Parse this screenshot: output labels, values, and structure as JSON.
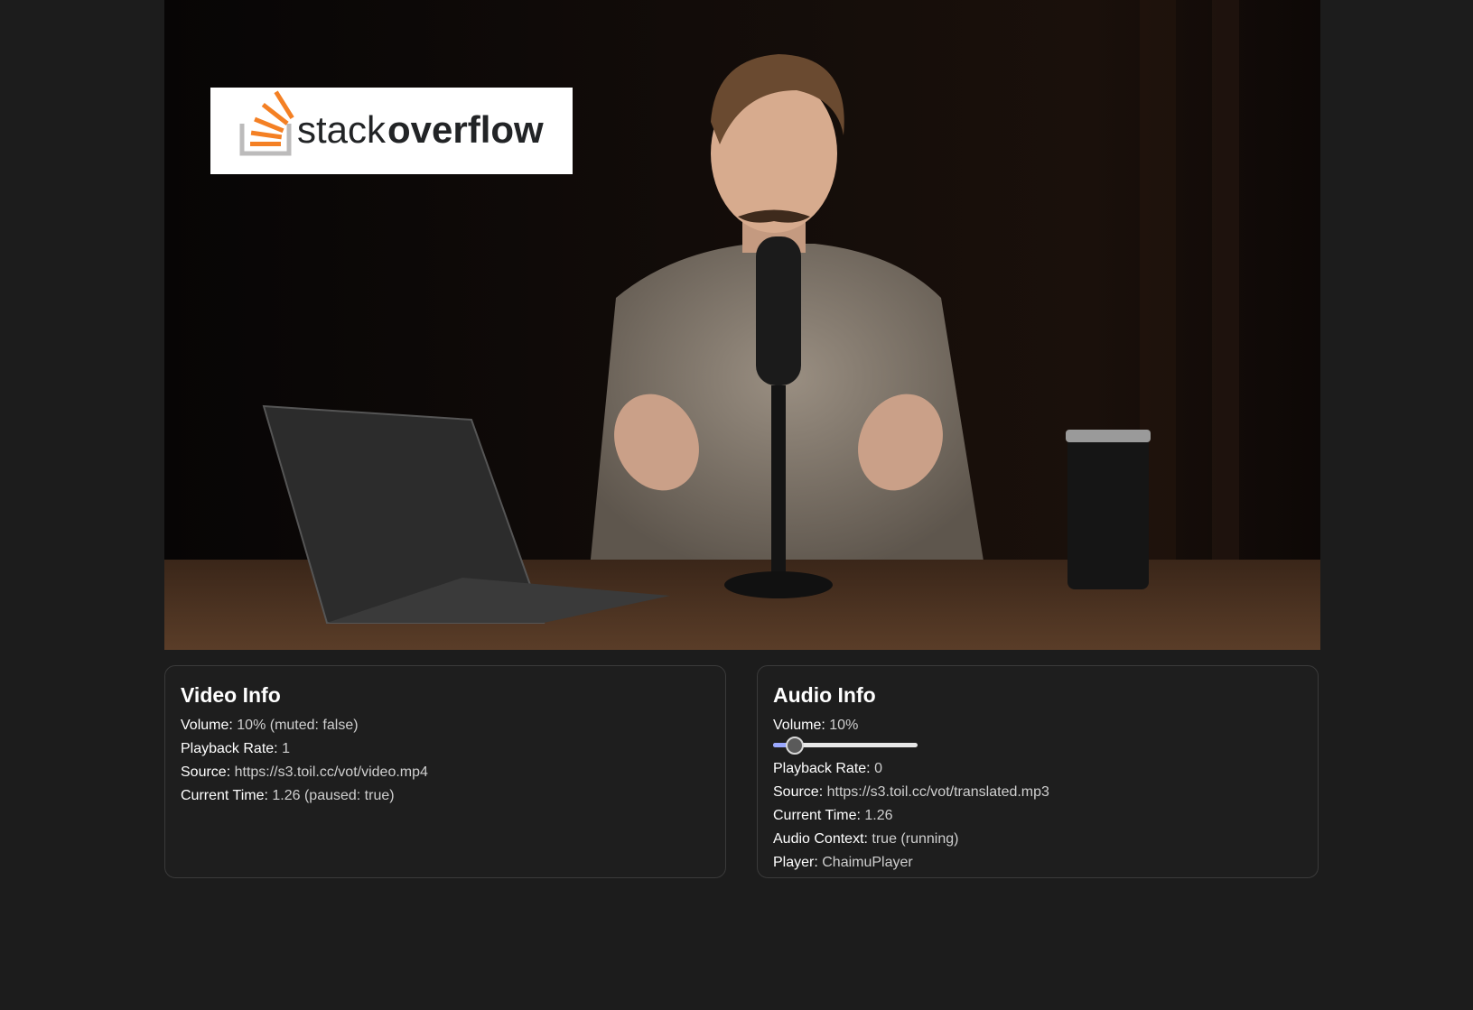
{
  "video_frame": {
    "logo": {
      "word1": "stack",
      "word2": "overflow",
      "brand_color": "#f48024"
    }
  },
  "video_info": {
    "title": "Video Info",
    "volume_label": "Volume:",
    "volume_value": "10% (muted: false)",
    "playback_rate_label": "Playback Rate:",
    "playback_rate_value": "1",
    "source_label": "Source:",
    "source_value": "https://s3.toil.cc/vot/video.mp4",
    "current_time_label": "Current Time:",
    "current_time_value": "1.26 (paused: true)"
  },
  "audio_info": {
    "title": "Audio Info",
    "volume_label": "Volume:",
    "volume_value": "10%",
    "volume_level": 0.1,
    "playback_rate_label": "Playback Rate:",
    "playback_rate_value": "0",
    "source_label": "Source:",
    "source_value": "https://s3.toil.cc/vot/translated.mp3",
    "current_time_label": "Current Time:",
    "current_time_value": "1.26",
    "audio_context_label": "Audio Context:",
    "audio_context_value": "true (running)",
    "player_label": "Player:",
    "player_value": "ChaimuPlayer"
  }
}
